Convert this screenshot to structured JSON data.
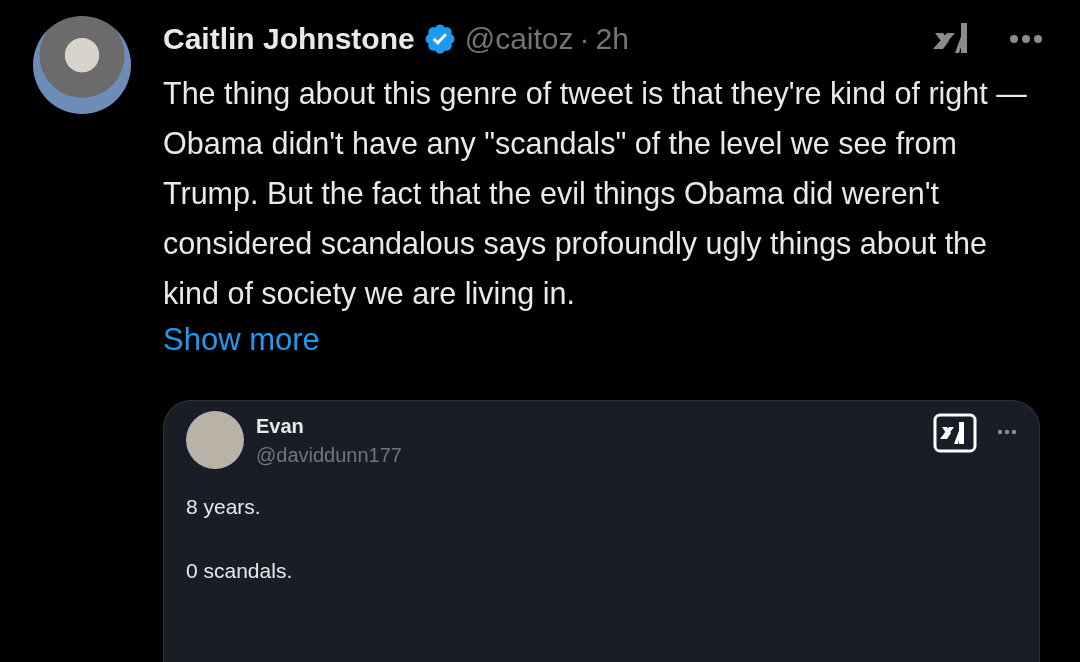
{
  "post": {
    "author": "Caitlin Johnstone",
    "verified": true,
    "handle": "@caitoz",
    "separator": "·",
    "time": "2h",
    "text": "The thing about this genre of tweet is that they're kind of right — Obama didn't have any \"scandals\" of the level we see from Trump. But the fact that the evil things Obama did weren't considered scandalous says profoundly ugly things about the kind of society we are living in.",
    "show_more": "Show more"
  },
  "quoted_post": {
    "author": "Evan",
    "handle": "@daviddunn177",
    "lines": [
      "8 years.",
      "0 scandals."
    ]
  }
}
